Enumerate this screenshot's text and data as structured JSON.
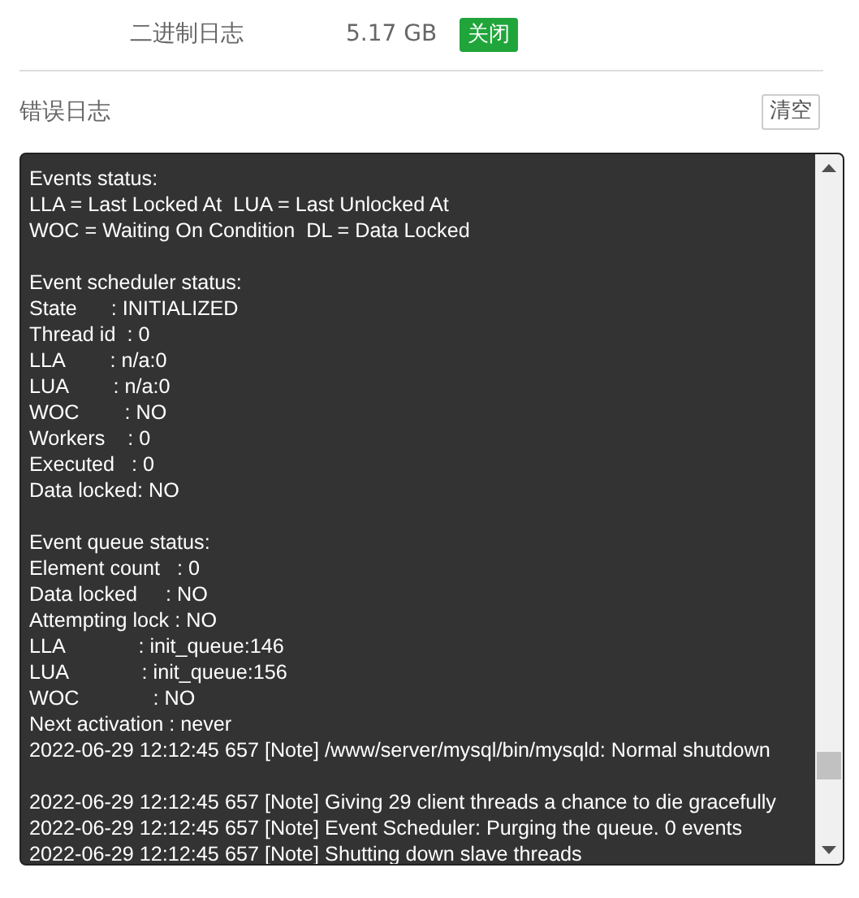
{
  "binlog_row": {
    "label": "二进制日志",
    "size": "5.17 GB",
    "toggle": "关闭"
  },
  "error_log": {
    "title": "错误日志",
    "clear_button": "清空",
    "blocks": [
      [
        "Events status:",
        "LLA = Last Locked At  LUA = Last Unlocked At",
        "WOC = Waiting On Condition  DL = Data Locked"
      ],
      [
        "Event scheduler status:",
        "State      : INITIALIZED",
        "Thread id  : 0",
        "LLA        : n/a:0",
        "LUA        : n/a:0",
        "WOC        : NO",
        "Workers    : 0",
        "Executed   : 0",
        "Data locked: NO"
      ],
      [
        "Event queue status:",
        "Element count   : 0",
        "Data locked     : NO",
        "Attempting lock : NO",
        "LLA             : init_queue:146",
        "LUA             : init_queue:156",
        "WOC             : NO",
        "Next activation : never",
        "2022-06-29 12:12:45 657 [Note] /www/server/mysql/bin/mysqld: Normal shutdown"
      ],
      [
        "2022-06-29 12:12:45 657 [Note] Giving 29 client threads a chance to die gracefully",
        "2022-06-29 12:12:45 657 [Note] Event Scheduler: Purging the queue. 0 events",
        "2022-06-29 12:12:45 657 [Note] Shutting down slave threads"
      ]
    ]
  }
}
